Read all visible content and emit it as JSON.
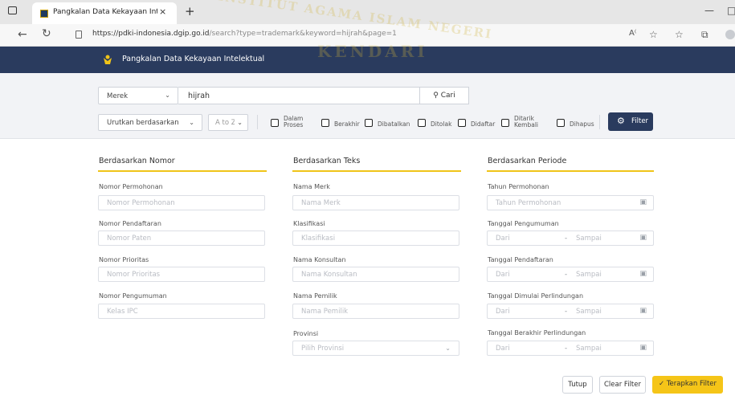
{
  "browser": {
    "tab_title": "Pangkalan Data Kekayaan Intele",
    "tab_close": "×",
    "new_tab": "+",
    "url_main": "https://pdki-indonesia.dgip.go.id",
    "url_path": "/search?type=trademark&keyword=hijrah&page=1"
  },
  "site": {
    "title": "Pangkalan Data Kekayaan Intelektual"
  },
  "search": {
    "type_value": "Merek",
    "keyword": "hijrah",
    "search_label": "Cari",
    "sort_value": "Urutkan berdasarkan",
    "order_value": "A to Z",
    "status_filters": [
      {
        "label": "Dalam Proses"
      },
      {
        "label": "Berakhir"
      },
      {
        "label": "Dibatalkan"
      },
      {
        "label": "Ditolak"
      },
      {
        "label": "Didaftar"
      },
      {
        "label": "Ditarik Kembali"
      },
      {
        "label": "Dihapus"
      }
    ],
    "filter_label": "Filter"
  },
  "form": {
    "col1": {
      "heading": "Berdasarkan Nomor",
      "fields": [
        {
          "label": "Nomor Permohonan",
          "placeholder": "Nomor Permohonan"
        },
        {
          "label": "Nomor Pendaftaran",
          "placeholder": "Nomor Paten"
        },
        {
          "label": "Nomor Prioritas",
          "placeholder": "Nomor Prioritas"
        },
        {
          "label": "Nomor Pengumuman",
          "placeholder": "Kelas IPC"
        }
      ]
    },
    "col2": {
      "heading": "Berdasarkan Teks",
      "fields": [
        {
          "label": "Nama Merk",
          "placeholder": "Nama Merk"
        },
        {
          "label": "Klasifikasi",
          "placeholder": "Klasifikasi"
        },
        {
          "label": "Nama Konsultan",
          "placeholder": "Nama Konsultan"
        },
        {
          "label": "Nama Pemilik",
          "placeholder": "Nama Pemilik"
        },
        {
          "label": "Provinsi",
          "placeholder": "Pilih Provinsi"
        }
      ]
    },
    "col3": {
      "heading": "Berdasarkan Periode",
      "fields": [
        {
          "label": "Tahun Permohonan",
          "placeholder": "Tahun Permohonan"
        },
        {
          "label": "Tanggal Pengumuman",
          "from": "Dari",
          "to": "Sampai"
        },
        {
          "label": "Tanggal Pendaftaran",
          "from": "Dari",
          "to": "Sampai"
        },
        {
          "label": "Tanggal Dimulai Perlindungan",
          "from": "Dari",
          "to": "Sampai"
        },
        {
          "label": "Tanggal Berakhir Perlindungan",
          "from": "Dari",
          "to": "Sampai"
        }
      ]
    }
  },
  "actions": {
    "close_label": "Tutup",
    "clear_label": "Clear Filter",
    "apply_label": "Terapkan Filter"
  },
  "watermark": {
    "line1": "INSTITUT AGAMA ISLAM NEGERI",
    "line2": "KENDARI"
  },
  "colors": {
    "header_bg": "#2a3b5e",
    "accent": "#f0c419",
    "apply_bg": "#f5c518"
  }
}
